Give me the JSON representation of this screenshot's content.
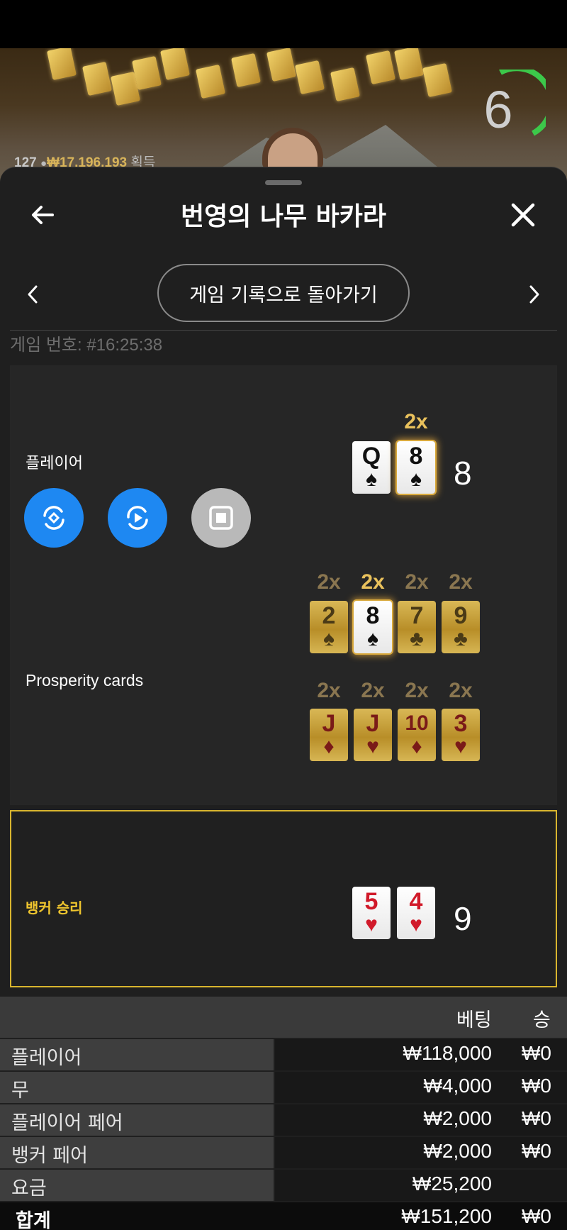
{
  "video": {
    "timer_value": "6",
    "winners_count": "127",
    "winners_amount": "₩17,196,193",
    "winners_label": "획득"
  },
  "header": {
    "title": "번영의 나무 바카라",
    "back_icon": "arrow-left-icon",
    "close_icon": "close-icon"
  },
  "nav": {
    "return_label": "게임 기록으로 돌아가기",
    "prev_icon": "chevron-left-icon",
    "next_icon": "chevron-right-icon"
  },
  "game": {
    "number_text": "게임 번호: #16:25:38"
  },
  "player": {
    "label": "플레이어",
    "score": "8",
    "cards": [
      {
        "rank": "Q",
        "suit": "♠",
        "multiplier": ""
      },
      {
        "rank": "8",
        "suit": "♠",
        "multiplier": "2x"
      }
    ],
    "controls": [
      "replay-icon",
      "play-icon",
      "stop-icon"
    ]
  },
  "prosperity": {
    "label": "Prosperity cards",
    "row1": [
      {
        "rank": "2",
        "suit": "♠",
        "multiplier": "2x"
      },
      {
        "rank": "8",
        "suit": "♠",
        "multiplier": "2x"
      },
      {
        "rank": "7",
        "suit": "♣",
        "multiplier": "2x"
      },
      {
        "rank": "9",
        "suit": "♣",
        "multiplier": "2x"
      }
    ],
    "row2": [
      {
        "rank": "J",
        "suit": "♦",
        "multiplier": "2x"
      },
      {
        "rank": "J",
        "suit": "♥",
        "multiplier": "2x"
      },
      {
        "rank": "10",
        "suit": "♦",
        "multiplier": "2x"
      },
      {
        "rank": "3",
        "suit": "♥",
        "multiplier": "2x"
      }
    ]
  },
  "banker": {
    "label": "뱅커 승리",
    "score": "9",
    "cards": [
      {
        "rank": "5",
        "suit": "♥"
      },
      {
        "rank": "4",
        "suit": "♥"
      }
    ]
  },
  "bets_table": {
    "headers": {
      "bet": "베팅",
      "win": "승"
    },
    "rows": [
      {
        "name": "플레이어",
        "bet": "₩118,000",
        "win": "₩0"
      },
      {
        "name": "무",
        "bet": "₩4,000",
        "win": "₩0"
      },
      {
        "name": "플레이어 페어",
        "bet": "₩2,000",
        "win": "₩0"
      },
      {
        "name": "뱅커 페어",
        "bet": "₩2,000",
        "win": "₩0"
      },
      {
        "name": "요금",
        "bet": "₩25,200",
        "win": ""
      }
    ],
    "total": {
      "name": "합계",
      "bet": "₩151,200",
      "win": "₩0"
    }
  },
  "colors": {
    "accent_blue": "#1e88f2",
    "banker_gold": "#f0c62e",
    "multiplier_gold": "#e9c15c",
    "timer_green": "#3cc84a"
  }
}
